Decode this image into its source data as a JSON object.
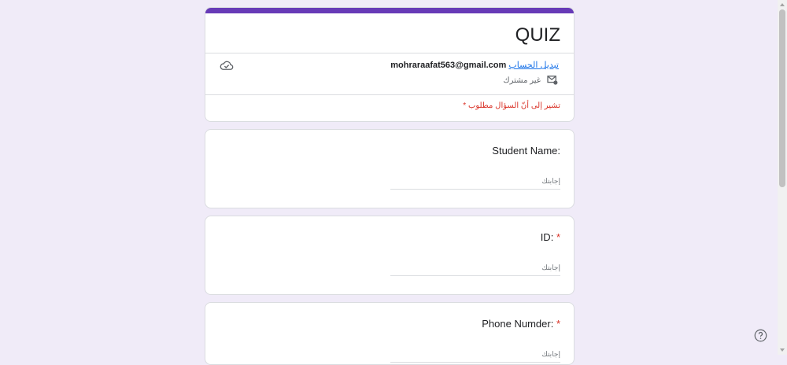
{
  "form": {
    "title": "QUIZ",
    "email": "mohraraafat563@gmail.com",
    "switch_account": "تبديل الحساب",
    "not_shared": "غير مشترك",
    "required_note": "* تشير إلى أنّ السؤال مطلوب"
  },
  "questions": [
    {
      "title": "Student Name:",
      "required": "",
      "placeholder": "إجابتك"
    },
    {
      "title": "ID:",
      "required": "*",
      "placeholder": "إجابتك"
    },
    {
      "title": "Phone Numder:",
      "required": "*",
      "placeholder": "إجابتك"
    }
  ],
  "icons": {
    "cloud": "cloud-check-icon",
    "share": "mail-share-icon",
    "help": "help-icon"
  },
  "colors": {
    "accent": "#673ab7",
    "background": "#f0ebf8",
    "required": "#d93025",
    "link": "#1a73e8"
  }
}
